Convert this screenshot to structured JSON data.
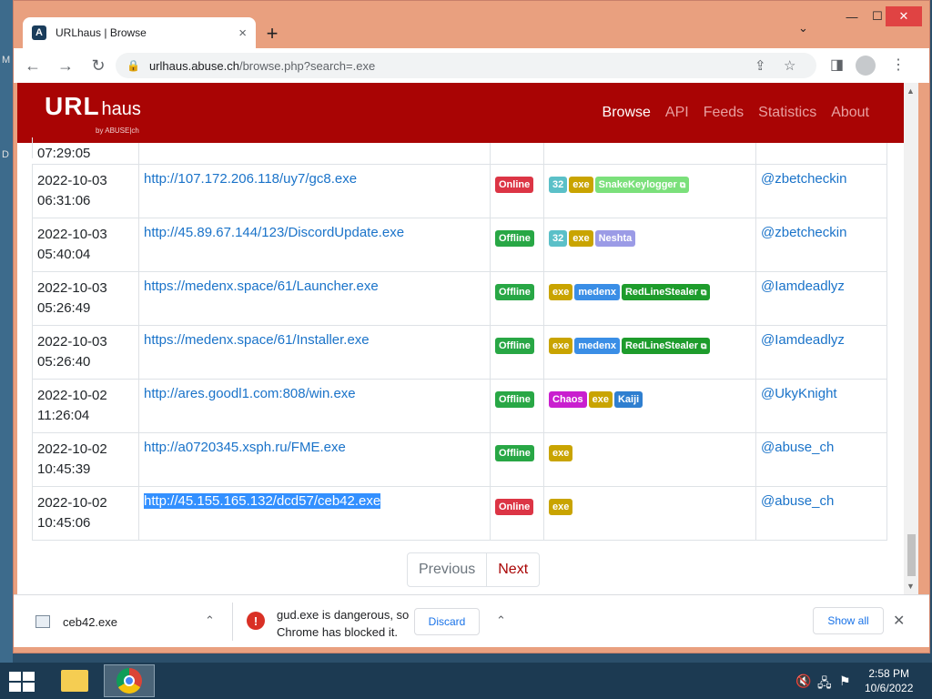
{
  "window": {
    "tab_title": "URLhaus | Browse",
    "tab_close": "×",
    "new_tab": "+",
    "tab_menu": "⌄",
    "min": "—",
    "max": "☐",
    "close": "✕"
  },
  "toolbar": {
    "back": "←",
    "forward": "→",
    "reload": "↻",
    "lock": "🔒",
    "url_host": "urlhaus.abuse.ch",
    "url_path": "/browse.php?search=.exe",
    "share": "⇪",
    "bookmark": "☆",
    "sidepanel": "◨",
    "menu": "⋮"
  },
  "site": {
    "brand_url": "URL",
    "brand_haus": "haus",
    "brand_by": "by ABUSE|ch",
    "nav": [
      {
        "label": "Browse",
        "active": true
      },
      {
        "label": "API",
        "active": false
      },
      {
        "label": "Feeds",
        "active": false
      },
      {
        "label": "Statistics",
        "active": false
      },
      {
        "label": "About",
        "active": false
      }
    ]
  },
  "table": {
    "first_row_time": "07:29:05",
    "rows": [
      {
        "date": "2022-10-03",
        "time": "06:31:06",
        "url": "http://107.172.206.118/uy7/gc8.exe",
        "status": "Online",
        "tags": [
          "32",
          "exe",
          "SnakeKeylogger"
        ],
        "reporter": "@zbetcheckin"
      },
      {
        "date": "2022-10-03",
        "time": "05:40:04",
        "url": "http://45.89.67.144/123/DiscordUpdate.exe",
        "status": "Offline",
        "tags": [
          "32",
          "exe",
          "Neshta"
        ],
        "reporter": "@zbetcheckin"
      },
      {
        "date": "2022-10-03",
        "time": "05:26:49",
        "url": "https://medenx.space/61/Launcher.exe",
        "status": "Offline",
        "tags": [
          "exe",
          "medenx",
          "RedLineStealer"
        ],
        "reporter": "@Iamdeadlyz"
      },
      {
        "date": "2022-10-03",
        "time": "05:26:40",
        "url": "https://medenx.space/61/Installer.exe",
        "status": "Offline",
        "tags": [
          "exe",
          "medenx",
          "RedLineStealer"
        ],
        "reporter": "@Iamdeadlyz"
      },
      {
        "date": "2022-10-02",
        "time": "11:26:04",
        "url": "http://ares.goodl1.com:808/win.exe",
        "status": "Offline",
        "tags": [
          "Chaos",
          "exe",
          "Kaiji"
        ],
        "reporter": "@UkyKnight"
      },
      {
        "date": "2022-10-02",
        "time": "10:45:39",
        "url": "http://a0720345.xsph.ru/FME.exe",
        "status": "Offline",
        "tags": [
          "exe"
        ],
        "reporter": "@abuse_ch"
      },
      {
        "date": "2022-10-02",
        "time": "10:45:06",
        "url": "http://45.155.165.132/dcd57/ceb42.exe",
        "status": "Online",
        "tags": [
          "exe"
        ],
        "reporter": "@abuse_ch"
      }
    ]
  },
  "pager": {
    "prev": "Previous",
    "next": "Next"
  },
  "downloads": {
    "file_name": "ceb42.exe",
    "chevron": "⌃",
    "warning_line1": "gud.exe is dangerous, so",
    "warning_line2": "Chrome has blocked it.",
    "warning_icon": "!",
    "discard": "Discard",
    "show_all": "Show all",
    "close": "✕"
  },
  "taskbar": {
    "time": "2:58 PM",
    "date": "10/6/2022",
    "tray_sound": "🔇",
    "tray_network": "🖧",
    "tray_flag": "⚑"
  },
  "colors": {
    "brand_red": "#a90404",
    "link": "#1a73c9",
    "online": "#dc3545",
    "offline": "#28a745"
  }
}
